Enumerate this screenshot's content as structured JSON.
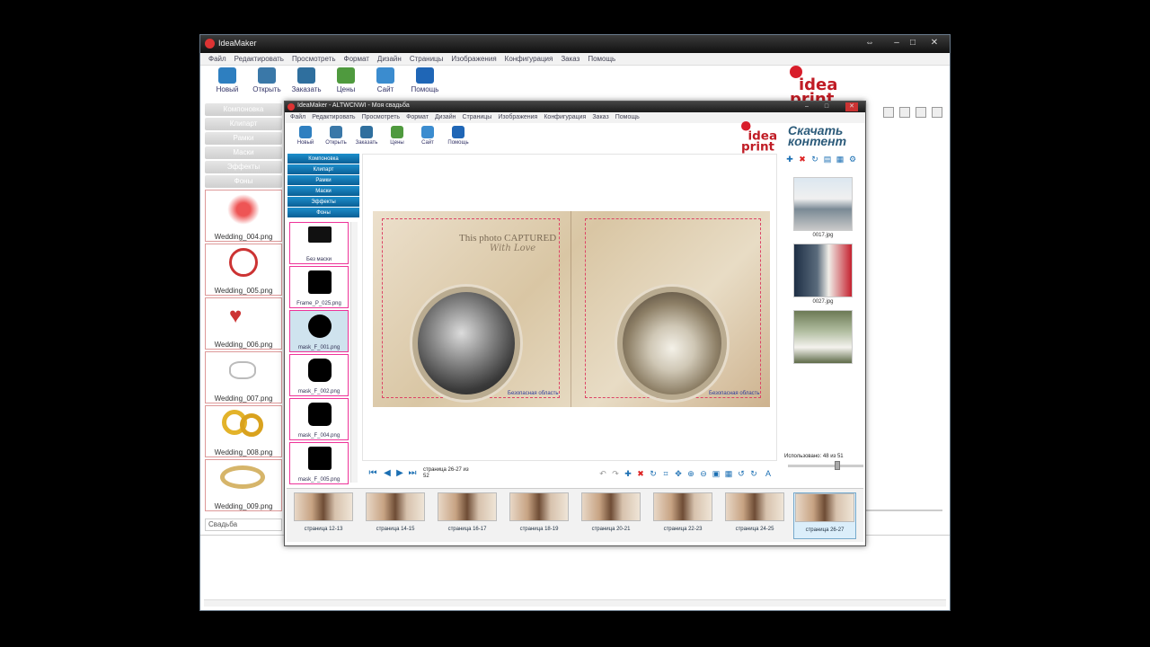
{
  "outer_window": {
    "title": "IdeaMaker",
    "menu": [
      "Файл",
      "Редактировать",
      "Просмотреть",
      "Формат",
      "Дизайн",
      "Страницы",
      "Изображения",
      "Конфигурация",
      "Заказ",
      "Помощь"
    ],
    "toolbar": [
      "Новый",
      "Открыть",
      "Заказать",
      "Цены",
      "Сайт",
      "Помощь"
    ],
    "left_tabs": [
      "Компоновка",
      "Клипарт",
      "Рамки",
      "Маски",
      "Эффекты",
      "Фоны"
    ],
    "clipart": [
      "Wedding_004.png",
      "Wedding_005.png",
      "Wedding_006.png",
      "Wedding_007.png",
      "Wedding_008.png",
      "Wedding_009.png"
    ],
    "category": "Свадьба",
    "logo": {
      "word1": "idea",
      "word2": "print"
    }
  },
  "inner_window": {
    "title": "IdeaMaker - ALTWCNWI - Моя свадьба",
    "menu": [
      "Файл",
      "Редактировать",
      "Просмотреть",
      "Формат",
      "Дизайн",
      "Страницы",
      "Изображения",
      "Конфигурация",
      "Заказ",
      "Помощь"
    ],
    "toolbar": [
      "Новый",
      "Открыть",
      "Заказать",
      "Цены",
      "Сайт",
      "Помощь"
    ],
    "logo": {
      "word1": "idea",
      "word2": "print"
    },
    "download": {
      "line1": "Скачать",
      "line2": "контент"
    },
    "tabs": [
      "Компоновка",
      "Клипарт",
      "Рамки",
      "Маски",
      "Эффекты",
      "Фоны"
    ],
    "masks": [
      "Без маски",
      "Frame_P_025.png",
      "mask_F_001.png",
      "mask_F_002.png",
      "mask_F_004.png",
      "mask_F_005.png"
    ],
    "spread": {
      "caption1": "This photo CAPTURED",
      "caption2": "With Love",
      "zone_left": "Безопасная область",
      "zone_right": "Безопасная область"
    },
    "navigation": {
      "page_info_1": "страница 26-27 из",
      "page_info_2": "52"
    },
    "right_files": [
      "0017.jpg",
      "0027.jpg"
    ],
    "used": "Использовано: 48 из 51",
    "filmstrip": [
      "страница 12-13",
      "страница 14-15",
      "страница 16-17",
      "страница 18-19",
      "страница 20-21",
      "страница 22-23",
      "страница 24-25",
      "страница 26-27"
    ],
    "selected_page_index": 7
  },
  "colors": {
    "accent_blue": "#0a6fb0",
    "logo_red": "#d81d2a",
    "download_blue": "#2c5b7a"
  }
}
